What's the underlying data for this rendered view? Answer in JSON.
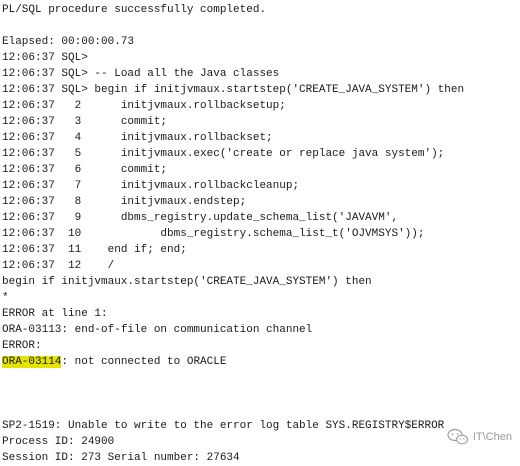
{
  "terminal": {
    "lines": [
      "PL/SQL procedure successfully completed.",
      "",
      "Elapsed: 00:00:00.73",
      "12:06:37 SQL>",
      "12:06:37 SQL> -- Load all the Java classes",
      "12:06:37 SQL> begin if initjvmaux.startstep('CREATE_JAVA_SYSTEM') then",
      "12:06:37   2      initjvmaux.rollbacksetup;",
      "12:06:37   3      commit;",
      "12:06:37   4      initjvmaux.rollbackset;",
      "12:06:37   5      initjvmaux.exec('create or replace java system');",
      "12:06:37   6      commit;",
      "12:06:37   7      initjvmaux.rollbackcleanup;",
      "12:06:37   8      initjvmaux.endstep;",
      "12:06:37   9      dbms_registry.update_schema_list('JAVAVM',",
      "12:06:37  10            dbms_registry.schema_list_t('OJVMSYS'));",
      "12:06:37  11    end if; end;",
      "12:06:37  12    /",
      "begin if initjvmaux.startstep('CREATE_JAVA_SYSTEM') then",
      "*",
      "ERROR at line 1:",
      "ORA-03113: end-of-file on communication channel",
      "ERROR:",
      "",
      "",
      "",
      "SP2-1519: Unable to write to the error log table SYS.REGISTRY$ERROR",
      "Process ID: 24900",
      "Session ID: 273 Serial number: 27634"
    ],
    "highlight_code": "ORA-03114",
    "highlight_rest": ": not connected to ORACLE",
    "highlight_color": "#e4e400"
  },
  "watermark": {
    "text": "IT\\Chen",
    "icon": "wechat-icon"
  }
}
